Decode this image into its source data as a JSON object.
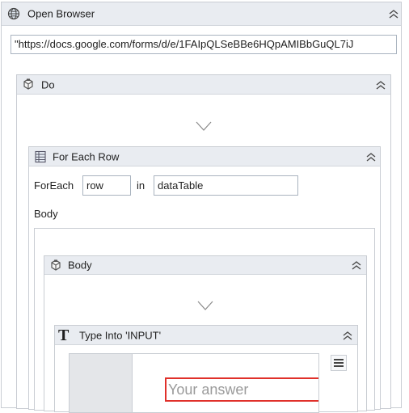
{
  "open_browser": {
    "title": "Open Browser",
    "url": "\"https://docs.google.com/forms/d/e/1FAIpQLSeBBe6HQpAMIBbGuQL7iJ"
  },
  "do_block": {
    "title": "Do"
  },
  "for_each_row": {
    "title": "For Each Row",
    "foreach_label": "ForEach",
    "item_var": "row",
    "in_label": "in",
    "collection": "dataTable",
    "body_label": "Body"
  },
  "body_block": {
    "title": "Body"
  },
  "type_into": {
    "title": "Type Into 'INPUT'",
    "preview_placeholder": "Your answer"
  },
  "colors": {
    "header_bg": "#e9ecf1",
    "border": "#c9cdd3",
    "highlight": "#e0302a"
  }
}
